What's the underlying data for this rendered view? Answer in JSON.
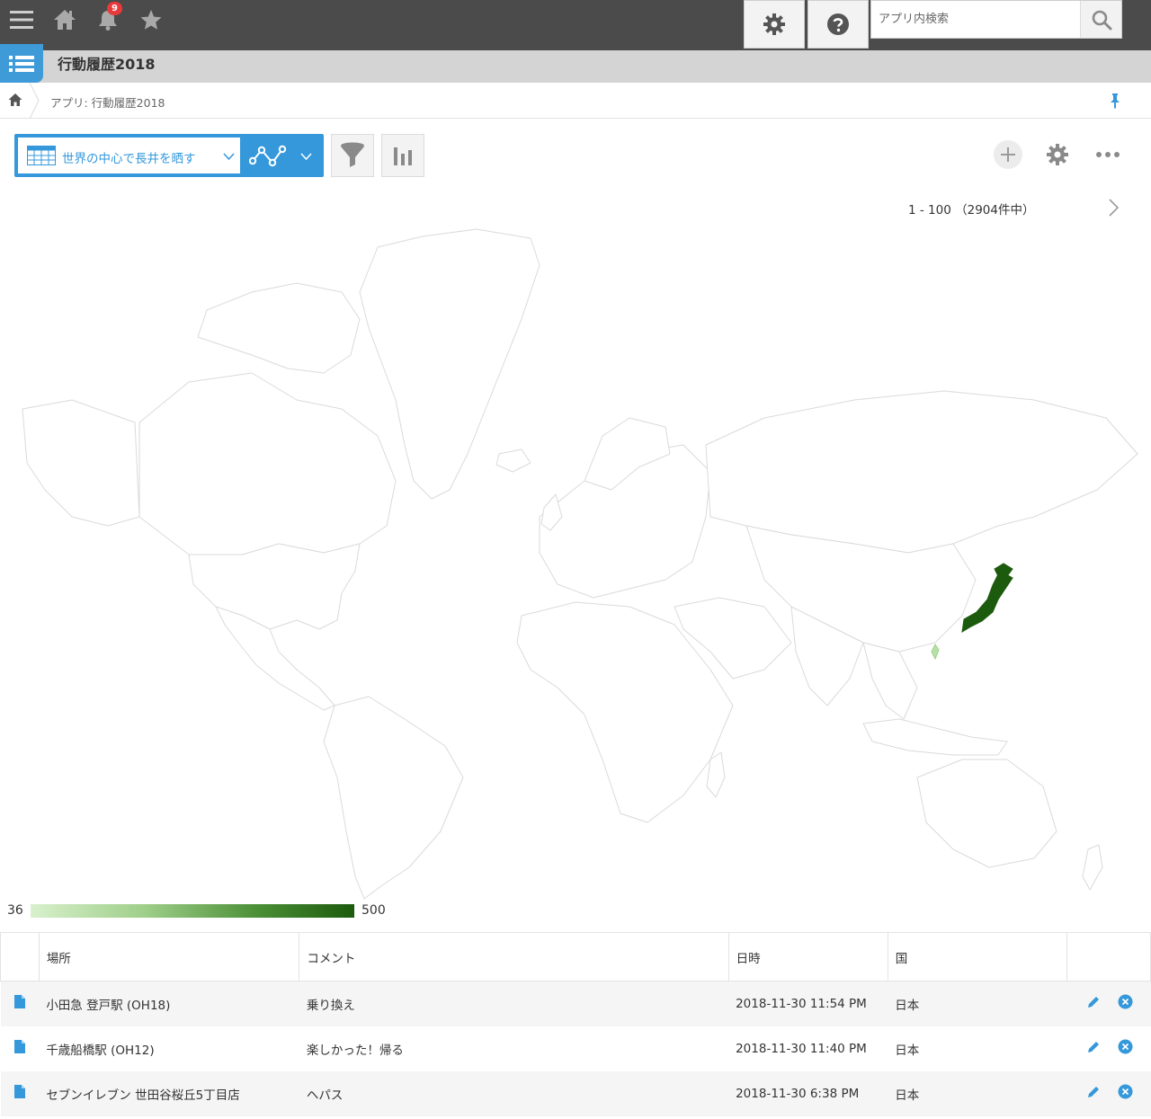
{
  "header": {
    "notification_count": "9",
    "search": {
      "placeholder": "アプリ内検索",
      "value": ""
    }
  },
  "app": {
    "title": "行動履歴2018"
  },
  "breadcrumb": {
    "text": "アプリ: 行動履歴2018"
  },
  "toolbar": {
    "view_name": "世界の中心で長井を晒す",
    "pager": "1 - 100 （2904件中）"
  },
  "legend": {
    "min": "36",
    "max": "500"
  },
  "colors": {
    "accent": "#3498db",
    "highlight_high": "#1c5a0d",
    "highlight_low": "#b7e0a6"
  },
  "table": {
    "columns": [
      "場所",
      "コメント",
      "日時",
      "国"
    ],
    "rows": [
      {
        "place": "小田急 登戸駅 (OH18)",
        "comment": "乗り換え",
        "datetime": "2018-11-30 11:54 PM",
        "country": "日本"
      },
      {
        "place": "千歳船橋駅 (OH12)",
        "comment": "楽しかった！帰る",
        "datetime": "2018-11-30 11:40 PM",
        "country": "日本"
      },
      {
        "place": "セブンイレブン 世田谷桜丘5丁目店",
        "comment": "ヘパス",
        "datetime": "2018-11-30 6:38 PM",
        "country": "日本"
      }
    ]
  }
}
